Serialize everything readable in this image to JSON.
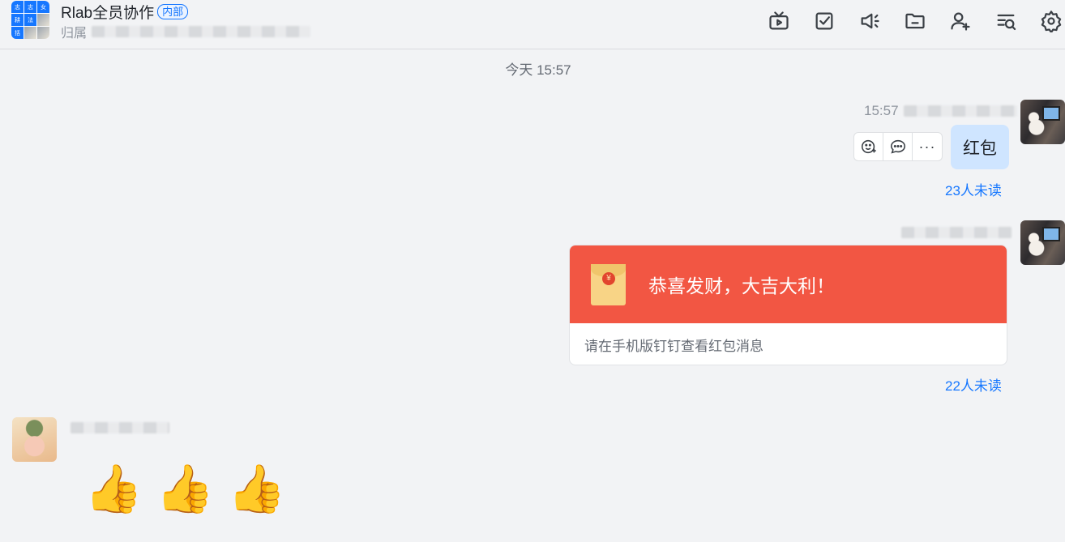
{
  "header": {
    "group_title": "Rlab全员协作",
    "badge": "内部",
    "subtitle_prefix": "归属",
    "avatar_cells": [
      "志",
      "志",
      "女",
      "耕",
      "法",
      "",
      "括",
      "",
      ""
    ]
  },
  "toolbar": {
    "icons": [
      "tv-icon",
      "task-check-icon",
      "announcement-icon",
      "folder-icon",
      "add-member-icon",
      "search-history-icon",
      "settings-icon"
    ]
  },
  "chat": {
    "time_divider": "今天 15:57",
    "msg1": {
      "time": "15:57",
      "text": "红包",
      "unread": "23人未读",
      "actions": [
        "add-reaction-icon",
        "reply-icon",
        "more-icon"
      ],
      "more_label": "···"
    },
    "msg2": {
      "envelope_title": "恭喜发财，大吉大利！",
      "envelope_hint": "请在手机版钉钉查看红包消息",
      "coin": "¥",
      "unread": "22人未读"
    },
    "msg3": {
      "emoji": [
        "👍",
        "👍",
        "👍"
      ]
    }
  },
  "colors": {
    "accent": "#1677ff",
    "envelope_red": "#f25643",
    "self_bubble": "#cfe5ff",
    "background": "#f2f3f5"
  }
}
